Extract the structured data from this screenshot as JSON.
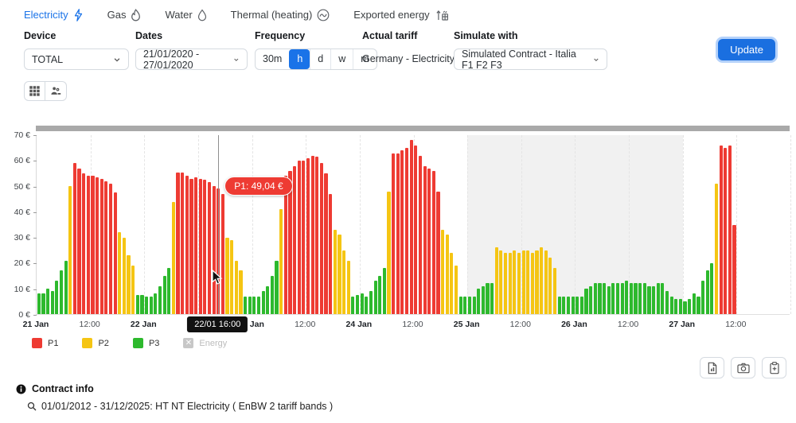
{
  "tabs": [
    {
      "label": "Electricity",
      "icon": "lightning-icon",
      "active": true
    },
    {
      "label": "Gas",
      "icon": "flame-icon",
      "active": false
    },
    {
      "label": "Water",
      "icon": "droplet-icon",
      "active": false
    },
    {
      "label": "Thermal (heating)",
      "icon": "thermal-icon",
      "active": false
    },
    {
      "label": "Exported energy",
      "icon": "exported-energy-icon",
      "active": false
    }
  ],
  "filters": {
    "device": {
      "label": "Device",
      "value": "TOTAL"
    },
    "dates": {
      "label": "Dates",
      "value": "21/01/2020 - 27/01/2020"
    },
    "frequency": {
      "label": "Frequency",
      "options": [
        "30m",
        "h",
        "d",
        "w",
        "m"
      ],
      "selected": "h"
    },
    "actual_tariff": {
      "label": "Actual tariff",
      "value": "Germany - Electricity"
    },
    "simulate_with": {
      "label": "Simulate with",
      "value": "Simulated Contract - Italia F1 F2 F3"
    },
    "update_label": "Update"
  },
  "view_toolbar": [
    {
      "name": "table-view-icon"
    },
    {
      "name": "chart-view-icon"
    }
  ],
  "colors": {
    "accent_blue": "#1a73e8",
    "P1": "#ee3b33",
    "P2": "#f5c513",
    "P3": "#2db92d",
    "disabled_gray": "#c7c7c7",
    "weekend_band": "#f1f1f1",
    "scrollbar": "#a9a9a9"
  },
  "chart_data": {
    "type": "bar",
    "title": "",
    "xlabel": "",
    "ylabel": "",
    "ylim": [
      0,
      70
    ],
    "grid": "vertical-dashed-every-12h",
    "legend_position": "bottom-left",
    "y_ticks": [
      "0 €",
      "10 €",
      "20 €",
      "30 €",
      "40 €",
      "50 €",
      "60 €",
      "70 €"
    ],
    "x_ticks": [
      {
        "label": "21 Jan",
        "slot": 0,
        "bold": true
      },
      {
        "label": "12:00",
        "slot": 12,
        "bold": false
      },
      {
        "label": "22 Jan",
        "slot": 24,
        "bold": true
      },
      {
        "label": "12:00",
        "slot": 36,
        "bold": false
      },
      {
        "label": "23 Jan",
        "slot": 48,
        "bold": true
      },
      {
        "label": "12:00",
        "slot": 60,
        "bold": false
      },
      {
        "label": "24 Jan",
        "slot": 72,
        "bold": true
      },
      {
        "label": "12:00",
        "slot": 84,
        "bold": false
      },
      {
        "label": "25 Jan",
        "slot": 96,
        "bold": true
      },
      {
        "label": "12:00",
        "slot": 108,
        "bold": false
      },
      {
        "label": "26 Jan",
        "slot": 120,
        "bold": true
      },
      {
        "label": "12:00",
        "slot": 132,
        "bold": false
      },
      {
        "label": "27 Jan",
        "slot": 144,
        "bold": true
      },
      {
        "label": "12:00",
        "slot": 156,
        "bold": false
      }
    ],
    "total_slots": 168,
    "slot_unit": "1 hour, 21/01/2020 00:00 - 27/01/2020 12:00",
    "series_legend": [
      {
        "name": "P1",
        "color": "#ee3b33",
        "disabled": false
      },
      {
        "name": "P2",
        "color": "#f5c513",
        "disabled": false
      },
      {
        "name": "P3",
        "color": "#2db92d",
        "disabled": false
      },
      {
        "name": "Energy",
        "color": "#c7c7c7",
        "disabled": true
      }
    ],
    "values": [
      8,
      8,
      10,
      9,
      13,
      17,
      21,
      50,
      59,
      57,
      55,
      54,
      54,
      53.5,
      53,
      52,
      51,
      47.5,
      32,
      30,
      23,
      19,
      7.5,
      7.5,
      7,
      7,
      8,
      11,
      15,
      18,
      44,
      55.5,
      55.5,
      54,
      53,
      53.5,
      53,
      52.5,
      51.5,
      50,
      49.04,
      47,
      30,
      29,
      21,
      17,
      7,
      7,
      7,
      7,
      9,
      11,
      15,
      21,
      41,
      54,
      56,
      58,
      60,
      60,
      61,
      62,
      61.5,
      59,
      55,
      47,
      33,
      31,
      25,
      21,
      7,
      7.5,
      8,
      7,
      9,
      13,
      15,
      18,
      48,
      63,
      63,
      64,
      65,
      68,
      66,
      62,
      58,
      57,
      56,
      48,
      33,
      31,
      24,
      19,
      7,
      7,
      7,
      7,
      10,
      11,
      12,
      12,
      26,
      25,
      24,
      24,
      25,
      24,
      25,
      25,
      24,
      25,
      26,
      25,
      22,
      18,
      7,
      7,
      7,
      7,
      7,
      7,
      10,
      11,
      12,
      12,
      12,
      11,
      12,
      12,
      12,
      13,
      12,
      12,
      12,
      12,
      11,
      11,
      12,
      12,
      9,
      7,
      6,
      6,
      5,
      6,
      8,
      7,
      13,
      17,
      20,
      51,
      66,
      65,
      66,
      35
    ],
    "bands": "333333321111111111222233333333211111111111222233333333211111111111222233333333211111111111222233333333222222222222223333333333333333333333333333333333321111",
    "weekend_band_slots": {
      "start": 96,
      "end": 144
    },
    "crosshair_slot": 40.5,
    "point_tooltip": {
      "text": "P1: 49,04 €",
      "series": "P1",
      "value": 49.04
    },
    "axis_tooltip": {
      "text": "22/01 16:00"
    }
  },
  "export_buttons": [
    {
      "name": "file-export-icon"
    },
    {
      "name": "camera-icon"
    },
    {
      "name": "clipboard-plus-icon"
    }
  ],
  "contract_info": {
    "title": "Contract info",
    "detail": "01/01/2012 - 31/12/2025: HT NT Electricity ( EnBW 2 tariff bands )"
  }
}
